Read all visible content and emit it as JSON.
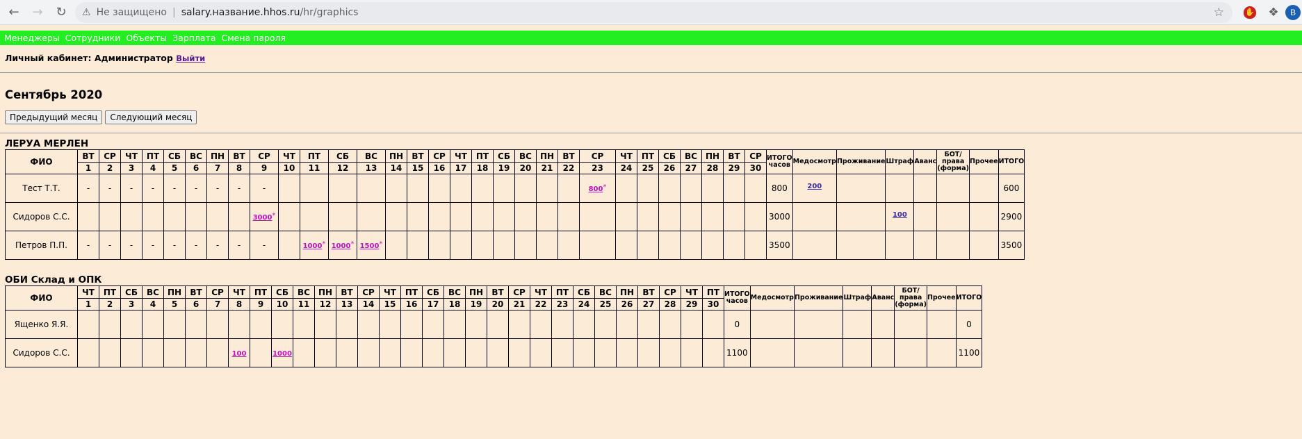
{
  "browser": {
    "insecure_label": "Не защищено",
    "url_host": "salary.название.hhos.ru",
    "url_path": "/hr/graphics",
    "avatar_letter": "B"
  },
  "menu": [
    "Менеджеры",
    "Сотрудники",
    "Объекты",
    "Зарплата",
    "Смена пароля"
  ],
  "cabinet": {
    "label": "Личный кабинет: Администратор",
    "logout": "Выйти"
  },
  "month_title": "Сентябрь 2020",
  "buttons": {
    "prev": "Предыдущий месяц",
    "next": "Следующий месяц"
  },
  "summary_headers": {
    "total_hours": "ИТОГО часов",
    "medical": "Медосмотр",
    "housing": "Проживание",
    "fine": "Штраф",
    "advance": "Аванс",
    "bot": "БОТ/ права (форма)",
    "other": "Прочее",
    "total": "ИТОГО"
  },
  "fio_header": "ФИО",
  "objects": [
    {
      "title": "ЛЕРУА МЕРЛЕН",
      "day_names": [
        "ВТ",
        "СР",
        "ЧТ",
        "ПТ",
        "СБ",
        "ВС",
        "ПН",
        "ВТ",
        "СР",
        "ЧТ",
        "ПТ",
        "СБ",
        "ВС",
        "ПН",
        "ВТ",
        "СР",
        "ЧТ",
        "ПТ",
        "СБ",
        "ВС",
        "ПН",
        "ВТ",
        "СР",
        "ЧТ",
        "ПТ",
        "СБ",
        "ВС",
        "ПН",
        "ВТ",
        "СР"
      ],
      "day_numbers": [
        "1",
        "2",
        "3",
        "4",
        "5",
        "6",
        "7",
        "8",
        "9",
        "10",
        "11",
        "12",
        "13",
        "14",
        "15",
        "16",
        "17",
        "18",
        "19",
        "20",
        "21",
        "22",
        "23",
        "24",
        "25",
        "26",
        "27",
        "28",
        "29",
        "30"
      ],
      "rows": [
        {
          "name": "Тест Т.Т.",
          "days": [
            "-",
            "-",
            "-",
            "-",
            "-",
            "-",
            "-",
            "-",
            "-",
            "",
            "",
            "",
            "",
            "",
            "",
            "",
            "",
            "",
            "",
            "",
            "",
            "",
            "800*",
            "",
            "",
            "",
            "",
            "",
            "",
            ""
          ],
          "total_hours": "800",
          "medical": "200",
          "housing": "",
          "fine": "",
          "advance": "",
          "bot": "",
          "other": "",
          "total": "600"
        },
        {
          "name": "Сидоров С.С.",
          "days": [
            "",
            "",
            "",
            "",
            "",
            "",
            "",
            "",
            "3000*",
            "",
            "",
            "",
            "",
            "",
            "",
            "",
            "",
            "",
            "",
            "",
            "",
            "",
            "",
            "",
            "",
            "",
            "",
            "",
            "",
            ""
          ],
          "total_hours": "3000",
          "medical": "",
          "housing": "",
          "fine": "100",
          "advance": "",
          "bot": "",
          "other": "",
          "total": "2900"
        },
        {
          "name": "Петров П.П.",
          "days": [
            "-",
            "-",
            "-",
            "-",
            "-",
            "-",
            "-",
            "-",
            "-",
            "",
            "1000*",
            "1000*",
            "1500*",
            "",
            "",
            "",
            "",
            "",
            "",
            "",
            "",
            "",
            "",
            "",
            "",
            "",
            "",
            "",
            "",
            ""
          ],
          "total_hours": "3500",
          "medical": "",
          "housing": "",
          "fine": "",
          "advance": "",
          "bot": "",
          "other": "",
          "total": "3500"
        }
      ]
    },
    {
      "title": "ОБИ Склад и ОПК",
      "day_names": [
        "ЧТ",
        "ПТ",
        "СБ",
        "ВС",
        "ПН",
        "ВТ",
        "СР",
        "ЧТ",
        "ПТ",
        "СБ",
        "ВС",
        "ПН",
        "ВТ",
        "СР",
        "ЧТ",
        "ПТ",
        "СБ",
        "ВС",
        "ПН",
        "ВТ",
        "СР",
        "ЧТ",
        "ПТ",
        "СБ",
        "ВС",
        "ПН",
        "ВТ",
        "СР",
        "ЧТ",
        "ПТ"
      ],
      "day_numbers": [
        "1",
        "2",
        "3",
        "4",
        "5",
        "6",
        "7",
        "8",
        "9",
        "10",
        "11",
        "12",
        "13",
        "14",
        "15",
        "16",
        "17",
        "18",
        "19",
        "20",
        "21",
        "22",
        "23",
        "24",
        "25",
        "26",
        "27",
        "28",
        "29",
        "30"
      ],
      "rows": [
        {
          "name": "Ященко Я.Я.",
          "days": [
            "",
            "",
            "",
            "",
            "",
            "",
            "",
            "",
            "",
            "",
            "",
            "",
            "",
            "",
            "",
            "",
            "",
            "",
            "",
            "",
            "",
            "",
            "",
            "",
            "",
            "",
            "",
            "",
            "",
            ""
          ],
          "total_hours": "0",
          "medical": "",
          "housing": "",
          "fine": "",
          "advance": "",
          "bot": "",
          "other": "",
          "total": "0"
        },
        {
          "name": "Сидоров С.С.",
          "days": [
            "",
            "",
            "",
            "",
            "",
            "",
            "",
            "100",
            "",
            "1000",
            "",
            "",
            "",
            "",
            "",
            "",
            "",
            "",
            "",
            "",
            "",
            "",
            "",
            "",
            "",
            "",
            "",
            "",
            "",
            ""
          ],
          "total_hours": "1100",
          "medical": "",
          "housing": "",
          "fine": "",
          "advance": "",
          "bot": "",
          "other": "",
          "total": "1100"
        }
      ]
    }
  ]
}
